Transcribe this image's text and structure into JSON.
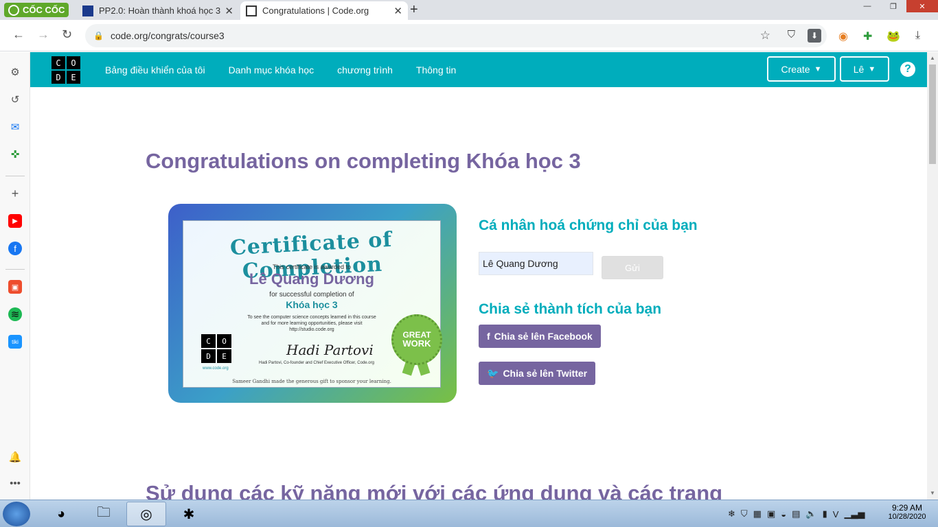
{
  "browser": {
    "brand": "CỐC CỐC",
    "tabs": [
      {
        "title": "PP2.0: Hoàn thành khoá học 3"
      },
      {
        "title": "Congratulations | Code.org"
      }
    ],
    "url": "code.org/congrats/course3"
  },
  "site": {
    "logo_letters": [
      "C",
      "O",
      "D",
      "E"
    ],
    "nav": [
      "Bảng điều khiển của tôi",
      "Danh mục khóa học",
      "chương trình",
      "Thông tin"
    ],
    "create_label": "Create",
    "user_label": "Lê",
    "help_label": "?"
  },
  "page": {
    "title": "Congratulations on completing Khóa học 3",
    "next_title": "Sử dụng các kỹ năng mới với các ứng dụng và các trang",
    "personalize_heading": "Cá nhân hoá chứng chỉ của bạn",
    "name_value": "Lê Quang Dương",
    "send_label": "Gửi",
    "share_heading": "Chia sẻ thành tích của bạn",
    "facebook_label": "Chia sẻ lên Facebook",
    "twitter_label": "Chia sẻ lên Twitter"
  },
  "certificate": {
    "title": "Certificate of Completion",
    "awarded": "This certificate is awarded to",
    "name": "Lê Quang Dương",
    "for": "for successful completion of",
    "course": "Khóa học 3",
    "note1": "To see the computer science concepts learned in this course",
    "note2": "and for more learning opportunities, please visit",
    "note3": "http://studio.code.org",
    "site": "www.code.org",
    "signature": "Hadi Partovi",
    "signer": "Hadi Partovi, Co-founder and Chief Executive Officer, Code.org",
    "sponsor": "Sameer Gandhi made the generous gift to sponsor your learning.",
    "seal_line1": "GREAT",
    "seal_line2": "WORK"
  },
  "taskbar": {
    "time": "9:29 AM",
    "date": "10/28/2020"
  },
  "colors": {
    "teal": "#00adbc",
    "purple": "#7665a0"
  }
}
